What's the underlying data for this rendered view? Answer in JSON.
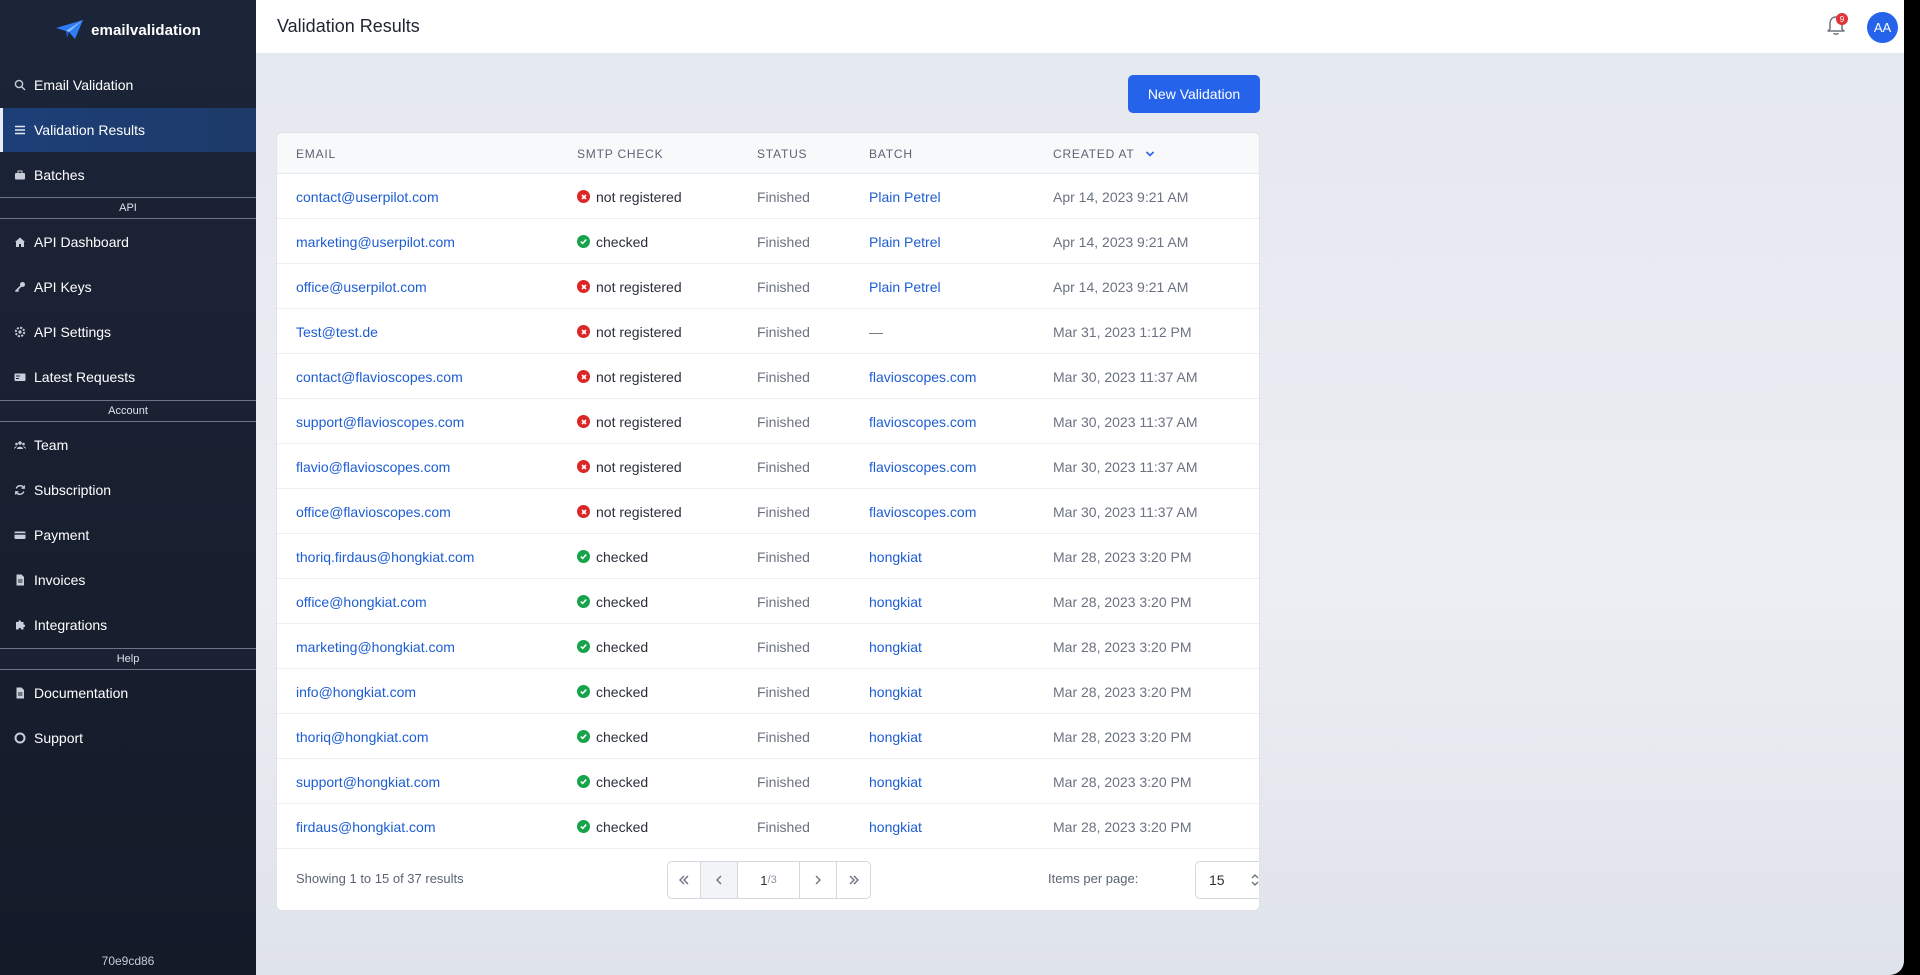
{
  "brand": {
    "name": "emailvalidation",
    "accent": "#2563eb"
  },
  "sidebar": {
    "items_main": [
      {
        "label": "Email Validation",
        "icon": "search-icon"
      },
      {
        "label": "Validation Results",
        "icon": "list-icon",
        "active": true
      },
      {
        "label": "Batches",
        "icon": "briefcase-icon"
      }
    ],
    "section_api": "API",
    "items_api": [
      {
        "label": "API Dashboard",
        "icon": "home-icon"
      },
      {
        "label": "API Keys",
        "icon": "key-icon"
      },
      {
        "label": "API Settings",
        "icon": "gear-icon"
      },
      {
        "label": "Latest Requests",
        "icon": "card-icon"
      }
    ],
    "section_account": "Account",
    "items_account": [
      {
        "label": "Team",
        "icon": "users-icon"
      },
      {
        "label": "Subscription",
        "icon": "refresh-icon"
      },
      {
        "label": "Payment",
        "icon": "credit-card-icon"
      },
      {
        "label": "Invoices",
        "icon": "document-icon"
      },
      {
        "label": "Integrations",
        "icon": "puzzle-icon"
      }
    ],
    "section_help": "Help",
    "items_help": [
      {
        "label": "Documentation",
        "icon": "document-icon"
      },
      {
        "label": "Support",
        "icon": "lifebuoy-icon"
      }
    ],
    "version": "70e9cd86"
  },
  "header": {
    "title": "Validation Results",
    "notification_count": "9",
    "avatar_initials": "AA"
  },
  "actions": {
    "new_validation": "New Validation"
  },
  "table": {
    "columns": {
      "email": "EMAIL",
      "smtp": "SMTP CHECK",
      "status": "STATUS",
      "batch": "BATCH",
      "created": "CREATED AT"
    },
    "rows": [
      {
        "email": "contact@userpilot.com",
        "smtp": "not registered",
        "ok": false,
        "status": "Finished",
        "batch": "Plain Petrel",
        "created": "Apr 14, 2023 9:21 AM"
      },
      {
        "email": "marketing@userpilot.com",
        "smtp": "checked",
        "ok": true,
        "status": "Finished",
        "batch": "Plain Petrel",
        "created": "Apr 14, 2023 9:21 AM"
      },
      {
        "email": "office@userpilot.com",
        "smtp": "not registered",
        "ok": false,
        "status": "Finished",
        "batch": "Plain Petrel",
        "created": "Apr 14, 2023 9:21 AM"
      },
      {
        "email": "Test@test.de",
        "smtp": "not registered",
        "ok": false,
        "status": "Finished",
        "batch": "—",
        "created": "Mar 31, 2023 1:12 PM"
      },
      {
        "email": "contact@flavioscopes.com",
        "smtp": "not registered",
        "ok": false,
        "status": "Finished",
        "batch": "flavioscopes.com",
        "created": "Mar 30, 2023 11:37 AM"
      },
      {
        "email": "support@flavioscopes.com",
        "smtp": "not registered",
        "ok": false,
        "status": "Finished",
        "batch": "flavioscopes.com",
        "created": "Mar 30, 2023 11:37 AM"
      },
      {
        "email": "flavio@flavioscopes.com",
        "smtp": "not registered",
        "ok": false,
        "status": "Finished",
        "batch": "flavioscopes.com",
        "created": "Mar 30, 2023 11:37 AM"
      },
      {
        "email": "office@flavioscopes.com",
        "smtp": "not registered",
        "ok": false,
        "status": "Finished",
        "batch": "flavioscopes.com",
        "created": "Mar 30, 2023 11:37 AM"
      },
      {
        "email": "thoriq.firdaus@hongkiat.com",
        "smtp": "checked",
        "ok": true,
        "status": "Finished",
        "batch": "hongkiat",
        "created": "Mar 28, 2023 3:20 PM"
      },
      {
        "email": "office@hongkiat.com",
        "smtp": "checked",
        "ok": true,
        "status": "Finished",
        "batch": "hongkiat",
        "created": "Mar 28, 2023 3:20 PM"
      },
      {
        "email": "marketing@hongkiat.com",
        "smtp": "checked",
        "ok": true,
        "status": "Finished",
        "batch": "hongkiat",
        "created": "Mar 28, 2023 3:20 PM"
      },
      {
        "email": "info@hongkiat.com",
        "smtp": "checked",
        "ok": true,
        "status": "Finished",
        "batch": "hongkiat",
        "created": "Mar 28, 2023 3:20 PM"
      },
      {
        "email": "thoriq@hongkiat.com",
        "smtp": "checked",
        "ok": true,
        "status": "Finished",
        "batch": "hongkiat",
        "created": "Mar 28, 2023 3:20 PM"
      },
      {
        "email": "support@hongkiat.com",
        "smtp": "checked",
        "ok": true,
        "status": "Finished",
        "batch": "hongkiat",
        "created": "Mar 28, 2023 3:20 PM"
      },
      {
        "email": "firdaus@hongkiat.com",
        "smtp": "checked",
        "ok": true,
        "status": "Finished",
        "batch": "hongkiat",
        "created": "Mar 28, 2023 3:20 PM"
      }
    ]
  },
  "pagination": {
    "showing": "Showing 1 to 15 of 37 results",
    "current_page": "1",
    "total_pages": "/3",
    "items_per_page_label": "Items per page:",
    "items_per_page": "15"
  }
}
